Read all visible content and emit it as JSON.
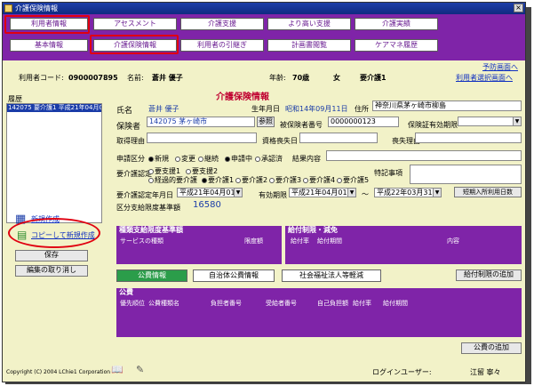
{
  "window": {
    "title": "介護保険情報",
    "close": "×"
  },
  "nav": {
    "row1": [
      "利用者情報",
      "アセスメント",
      "介護支援",
      "より高い支援",
      "介護実績"
    ],
    "row2": [
      "基本情報",
      "介護保険情報",
      "利用者の引継ぎ",
      "計画書閲覧",
      "ケアマネ履歴"
    ],
    "prev_screen": "予防画面へ"
  },
  "info": {
    "user_code_label": "利用者コード:",
    "user_code": "0900007895",
    "name_label": "名前:",
    "name": "蒼井 優子",
    "age_label": "年齢:",
    "age": "70歳",
    "sex": "女",
    "care_level": "要介護1",
    "select_link": "利用者選択画面へ"
  },
  "history": {
    "label": "履歴",
    "items": [
      "142075 要介護1 平成21年04月01日"
    ]
  },
  "sidebar": {
    "new_create": "新規作成",
    "copy_create": "コピーして新規作成",
    "save": "保存",
    "cancel": "編集の取り消し"
  },
  "form": {
    "section_title": "介護保険情報",
    "name_label": "氏名",
    "name_value": "蒼井 優子",
    "birth_label": "生年月日",
    "birth_value": "昭和14年09月11日",
    "address_label": "住所",
    "address_value": "神奈川県茅ヶ崎市柳島",
    "insurer_label": "保険者",
    "insurer_value": "142075 茅ヶ崎市",
    "ref_button": "参照",
    "insured_no_label": "被保険者番号",
    "insured_no_value": "0000000123",
    "cert_valid_label": "保険証有効期限",
    "acquire_reason_label": "取得理由",
    "qualify_date_label": "資格喪失日",
    "loss_reason_label": "喪失理由",
    "apply_label": "申請区分",
    "apply_options": [
      "新規",
      "変更",
      "継続",
      "申請中",
      "承認済"
    ],
    "result_label": "結果内容",
    "care_cert_label": "要介護認定",
    "support_opts": [
      "要支援1",
      "要支援2"
    ],
    "transition_opt": "経過的要介護",
    "care_opts": [
      "要介護1",
      "要介護2",
      "要介護3",
      "要介護4",
      "要介護5"
    ],
    "special_label": "特記事項",
    "cert_date_label": "要介護認定年月日",
    "cert_date": "平成21年04月01日",
    "valid_label": "有効期限",
    "valid_from": "平成21年04月01日",
    "tilde": "～",
    "valid_to": "平成22年03月31日",
    "short_stay_button": "短期入所利用日数",
    "limit_label": "区分支給限度基準額",
    "limit_value": "16580"
  },
  "service_table": {
    "title": "種類支給限度基準額",
    "cols": [
      "サービスの種類",
      "限度額"
    ]
  },
  "benefit_table": {
    "title": "給付制限・減免",
    "cols": [
      "給付率",
      "給付期間",
      "内容"
    ]
  },
  "tabs": [
    "公費情報",
    "自治体公費情報",
    "社会福祉法人等軽減"
  ],
  "benefit_add": "給付制限の追加",
  "public_table": {
    "title": "公費",
    "cols": [
      "優先順位",
      "公費種類名",
      "負担者番号",
      "受給者番号",
      "自己負担額",
      "給付率",
      "給付期間"
    ]
  },
  "public_add": "公費の追加",
  "footer": {
    "copyright": "Copyright (C) 2004 LChie1 Corporation",
    "login_label": "ログインユーザー:",
    "login_user": "江留 寧々"
  },
  "colors": {
    "purple": "#7f24a8",
    "bg": "#f2f2c8",
    "red": "#e00010"
  }
}
